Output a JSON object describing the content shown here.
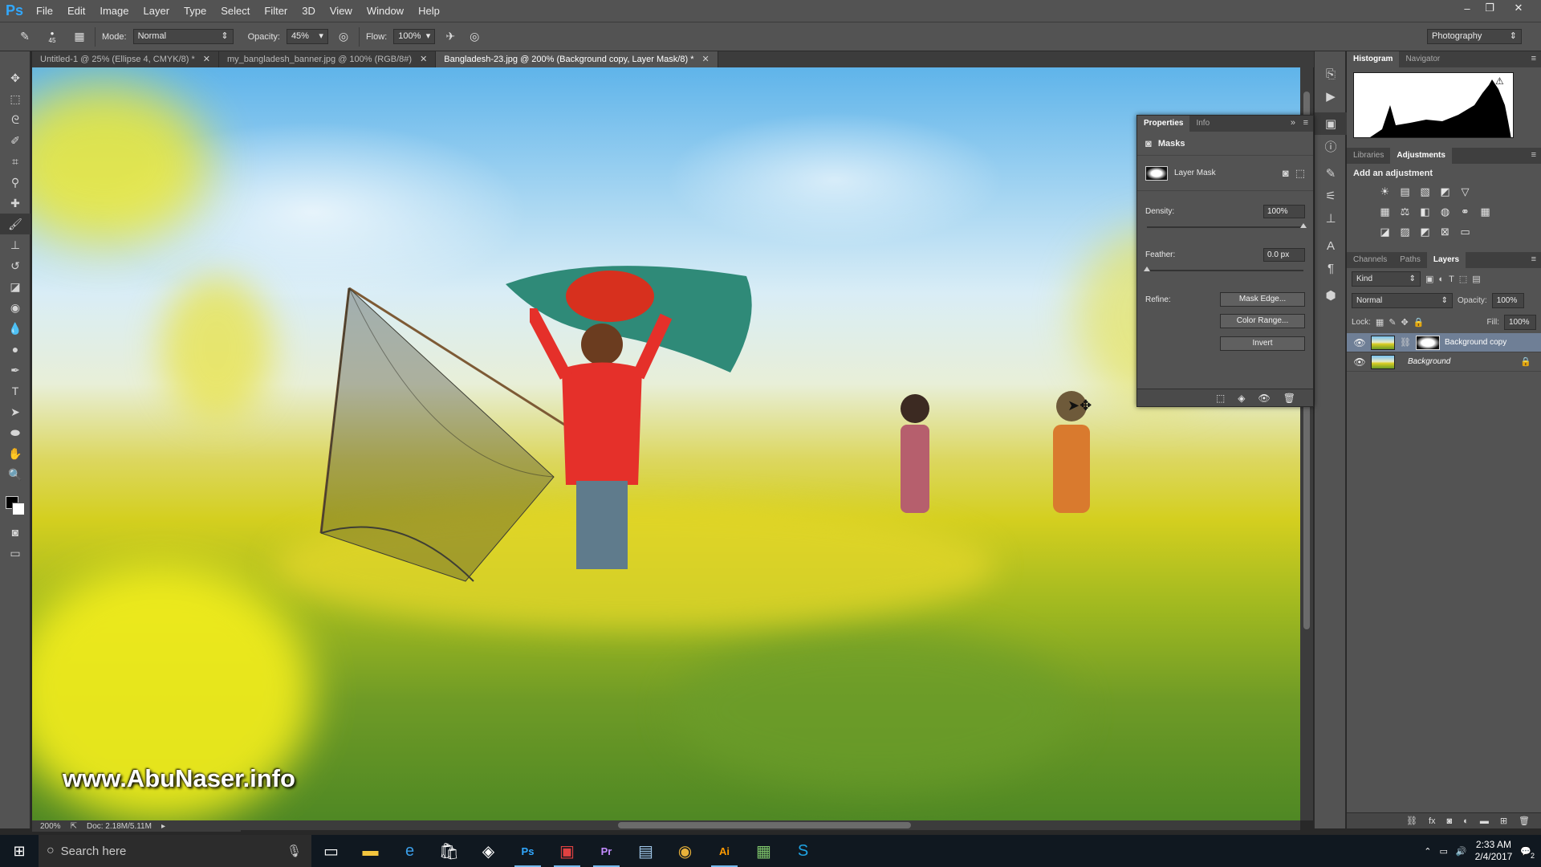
{
  "app": {
    "logo": "Ps",
    "menu": [
      "File",
      "Edit",
      "Image",
      "Layer",
      "Type",
      "Select",
      "Filter",
      "3D",
      "View",
      "Window",
      "Help"
    ],
    "window_controls": [
      "–",
      "❐",
      "✕"
    ]
  },
  "options_bar": {
    "brush_size": "45",
    "mode_label": "Mode:",
    "mode_value": "Normal",
    "opacity_label": "Opacity:",
    "opacity_value": "45%",
    "flow_label": "Flow:",
    "flow_value": "100%",
    "workspace": "Photography"
  },
  "tools": [
    "move-tool",
    "marquee-tool",
    "lasso-tool",
    "quick-selection-tool",
    "crop-tool",
    "eyedropper-tool",
    "spot-healing-tool",
    "brush-tool",
    "clone-stamp-tool",
    "history-brush-tool",
    "eraser-tool",
    "paint-bucket-tool",
    "blur-tool",
    "dodge-tool",
    "pen-tool",
    "type-tool",
    "path-selection-tool",
    "ellipse-tool",
    "hand-tool",
    "zoom-tool"
  ],
  "doc_tabs": [
    {
      "label": "Untitled-1 @ 25% (Ellipse 4, CMYK/8) *",
      "active": false
    },
    {
      "label": "my_bangladesh_banner.jpg @ 100% (RGB/8#)",
      "active": false
    },
    {
      "label": "Bangladesh-23.jpg @ 200% (Background copy, Layer Mask/8) *",
      "active": true
    }
  ],
  "canvas": {
    "watermark": "www.AbuNaser.info"
  },
  "status": {
    "zoom": "200%",
    "doc_size": "Doc: 2.18M/5.11M"
  },
  "histogram_panel": {
    "tabs": [
      "Histogram",
      "Navigator"
    ]
  },
  "adjustments_panel": {
    "tabs": [
      "Libraries",
      "Adjustments"
    ],
    "title": "Add an adjustment"
  },
  "layers_panel": {
    "tabs": [
      "Channels",
      "Paths",
      "Layers"
    ],
    "kind_filter": "Kind",
    "blend_mode": "Normal",
    "opacity_label": "Opacity:",
    "opacity_value": "100%",
    "lock_label": "Lock:",
    "fill_label": "Fill:",
    "fill_value": "100%",
    "layers": [
      {
        "name": "Background copy",
        "selected": true,
        "has_mask": true,
        "italic": false
      },
      {
        "name": "Background",
        "selected": false,
        "has_mask": false,
        "italic": true
      }
    ],
    "footer_icons": [
      "link-icon",
      "fx-icon",
      "mask-icon",
      "adjustment-icon",
      "folder-icon",
      "new-layer-icon",
      "trash-icon"
    ]
  },
  "properties_panel": {
    "tabs": [
      "Properties",
      "Info"
    ],
    "section_title": "Masks",
    "mask_type": "Layer Mask",
    "density_label": "Density:",
    "density_value": "100%",
    "density_level": 1.0,
    "feather_label": "Feather:",
    "feather_value": "0.0 px",
    "feather_level": 0.0,
    "refine_label": "Refine:",
    "buttons": [
      "Mask Edge...",
      "Color Range...",
      "Invert"
    ]
  },
  "taskbar": {
    "search_placeholder": "Search here",
    "apps": [
      "task-view",
      "file-explorer",
      "edge",
      "store",
      "app-5",
      "photoshop",
      "app-7",
      "premiere",
      "app-9",
      "chrome",
      "illustrator",
      "app-12",
      "skype"
    ],
    "time": "2:33 AM",
    "date": "2/4/2017",
    "notification_count": "2"
  },
  "colors": {
    "ui_dark": "#535353",
    "ui_darker": "#282828",
    "selected_layer": "#6f7f96",
    "taskbar": "#101820"
  }
}
